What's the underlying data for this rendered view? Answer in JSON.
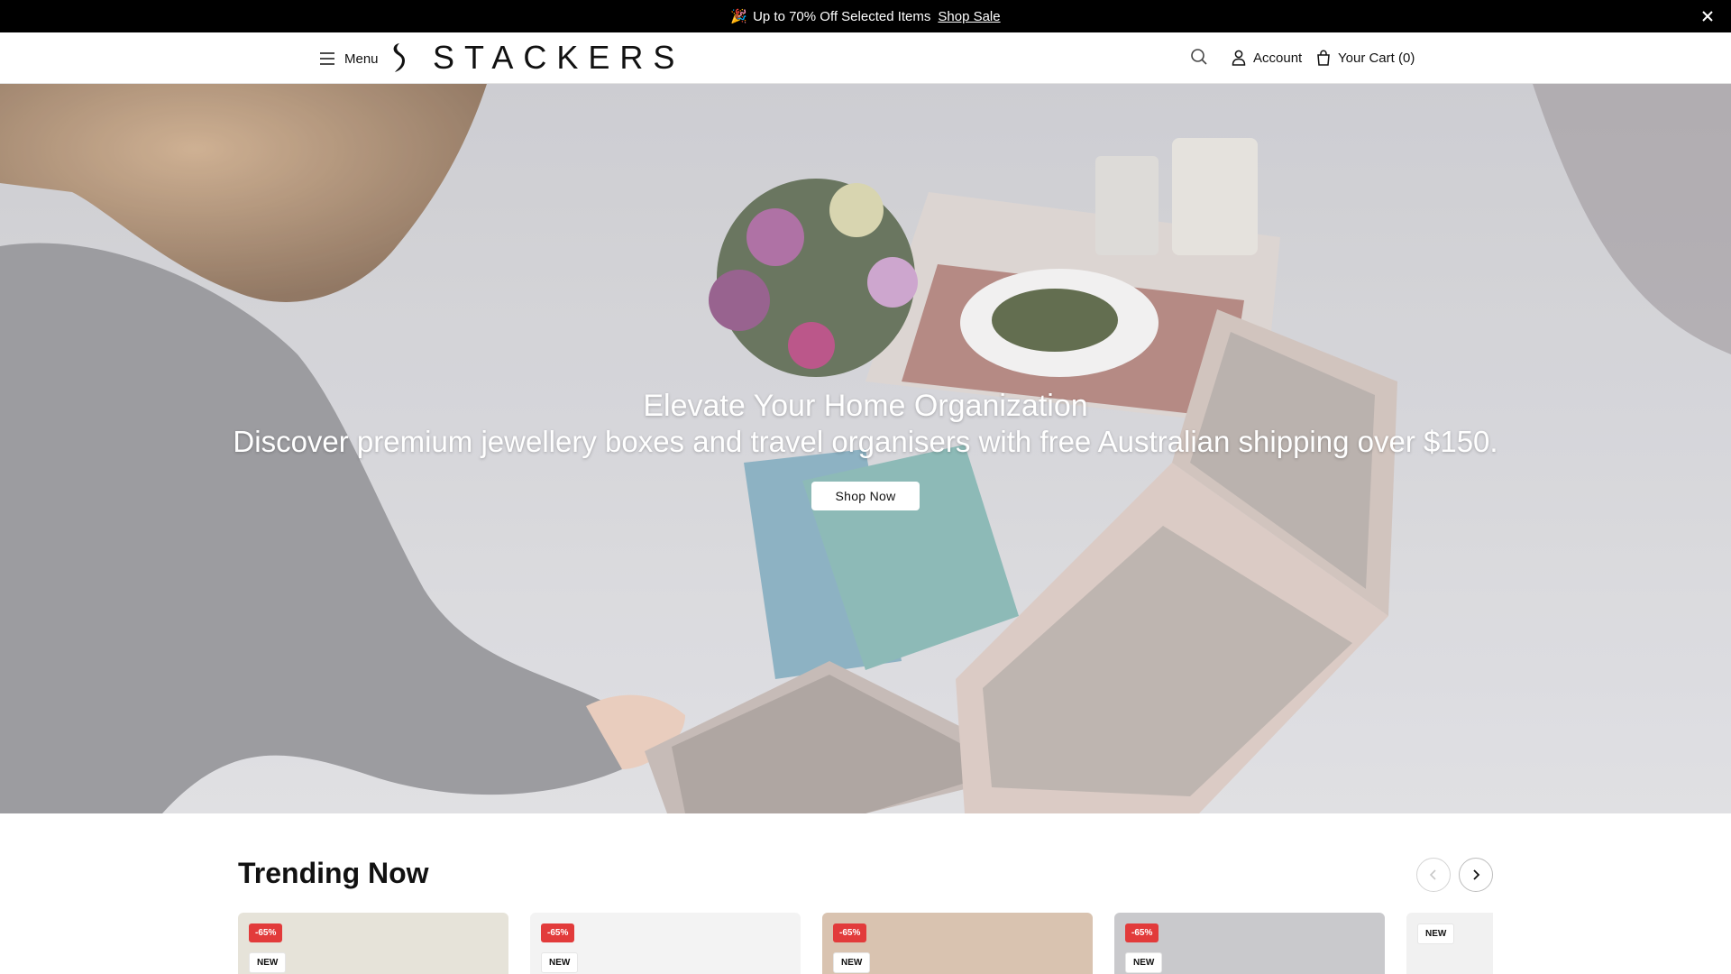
{
  "announcement": {
    "emoji": "🎉",
    "text": "Up to 70% Off Selected Items",
    "link": "Shop Sale"
  },
  "header": {
    "menu_label": "Menu",
    "logo_text": "STACKERS",
    "account_label": "Account",
    "cart_label": "Your Cart (0)"
  },
  "hero": {
    "title": "Elevate Your Home Organization",
    "subtitle": "Discover premium jewellery boxes and travel organisers with free Australian shipping over $150.",
    "cta": "Shop Now"
  },
  "trending": {
    "title": "Trending Now",
    "products": [
      {
        "discount": "-65%",
        "tag": "NEW",
        "bg": "#e6e3d9"
      },
      {
        "discount": "-65%",
        "tag": "NEW",
        "bg": "#f3f3f3"
      },
      {
        "discount": "-65%",
        "tag": "NEW",
        "bg": "#d9c3b0"
      },
      {
        "discount": "-65%",
        "tag": "NEW",
        "bg": "#c9c9cc"
      },
      {
        "discount": "",
        "tag": "NEW",
        "bg": "#f1f1f1"
      }
    ]
  },
  "colors": {
    "announcement_bg": "#000000",
    "sale_badge": "#e23b3b",
    "hero_overlay": "#bfc0c6"
  }
}
